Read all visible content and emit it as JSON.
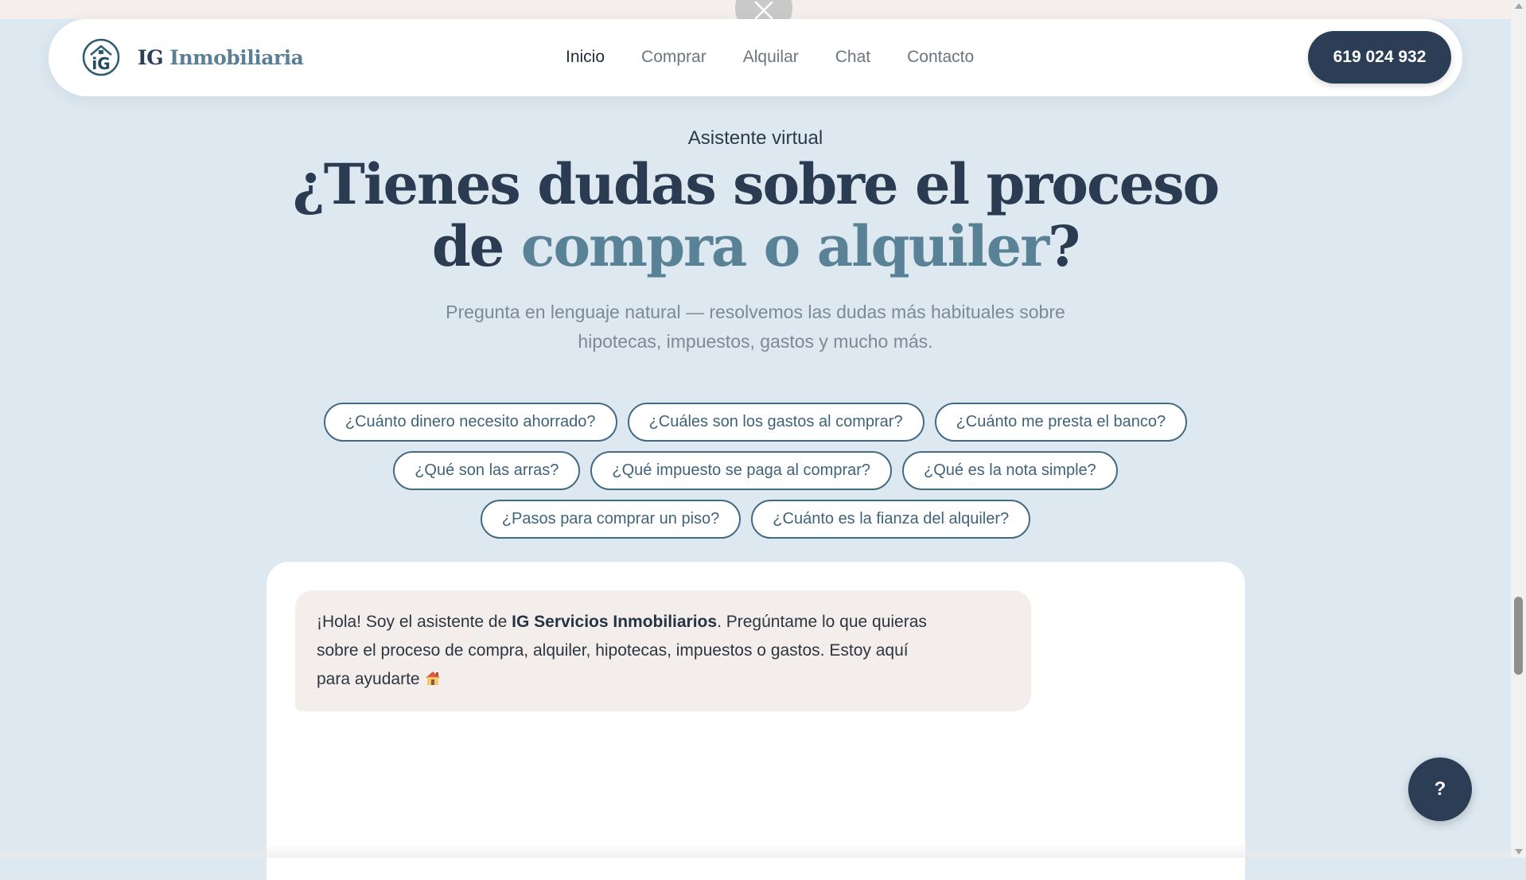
{
  "brand": {
    "name_part1": "IG",
    "name_part2": "Inmobiliaria",
    "logo_text": "iG",
    "logo_icon": "house-roof-icon"
  },
  "nav": {
    "items": [
      {
        "label": "Inicio",
        "active": true
      },
      {
        "label": "Comprar",
        "active": false
      },
      {
        "label": "Alquilar",
        "active": false
      },
      {
        "label": "Chat",
        "active": false
      },
      {
        "label": "Contacto",
        "active": false
      }
    ],
    "phone": "619 024 932"
  },
  "hero": {
    "eyebrow": "Asistente virtual",
    "headline_line1": "¿Tienes dudas sobre el proceso",
    "headline_line2_prefix": "de ",
    "headline_line2_highlight": "compra o alquiler",
    "headline_line2_suffix": "?",
    "subtitle_line1": "Pregunta en lenguaje natural — resolvemos las dudas más habituales sobre",
    "subtitle_line2": "hipotecas, impuestos, gastos y mucho más."
  },
  "chips": {
    "row1": [
      "¿Cuánto dinero necesito ahorrado?",
      "¿Cuáles son los gastos al comprar?",
      "¿Cuánto me presta el banco?"
    ],
    "row2": [
      "¿Qué son las arras?",
      "¿Qué impuesto se paga al comprar?",
      "¿Qué es la nota simple?"
    ],
    "row3": [
      "¿Pasos para comprar un piso?",
      "¿Cuánto es la fianza del alquiler?"
    ]
  },
  "chat": {
    "greeting_prefix": "¡Hola! Soy el asistente de ",
    "greeting_bold": "IG Servicios Inmobiliarios",
    "greeting_line1_suffix": ". Pregúntame lo que quieras",
    "greeting_line2": "sobre el proceso de compra, alquiler, hipotecas, impuestos o gastos. Estoy aquí",
    "greeting_line3": "para ayudarte",
    "greeting_icon": "house-icon"
  },
  "help_button": {
    "label": "?"
  },
  "colors": {
    "page_bg": "#dde8f1",
    "navy": "#2c3e56",
    "accent": "#5a8296",
    "chip_border": "#426a80",
    "bubble_bg": "#f3eeeb"
  }
}
